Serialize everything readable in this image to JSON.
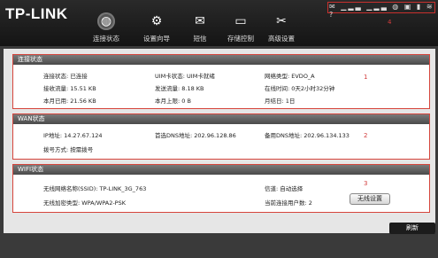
{
  "header": {
    "logo": "TP-LINK",
    "nav": [
      {
        "label": "连接状态",
        "icon": "globe-icon"
      },
      {
        "label": "设置向导",
        "icon": "gear-icon"
      },
      {
        "label": "短信",
        "icon": "mail-icon"
      },
      {
        "label": "存储控制",
        "icon": "storage-icon"
      },
      {
        "label": "高级设置",
        "icon": "tools-icon"
      }
    ],
    "status_icons": [
      "mail-icon",
      "signal-icon",
      "signal-icon",
      "globe-icon",
      "sim-icon",
      "battery-icon",
      "wifi-icon",
      "help-icon"
    ],
    "annotation": "4"
  },
  "connection": {
    "title": "连接状态",
    "mark": "1",
    "rows": [
      [
        "连接状态: 已连接",
        "UIM卡状态: UIM卡就绪",
        "网络类型: EVDO_A"
      ],
      [
        "接收流量: 15.51 KB",
        "发送流量: 8.18 KB",
        "在线时间: 0天2小时32分钟"
      ],
      [
        "本月已用: 21.56 KB",
        "本月上限: 0 B",
        "月结日: 1日"
      ]
    ]
  },
  "wan": {
    "title": "WAN状态",
    "mark": "2",
    "rows": [
      [
        "IP地址: 14.27.67.124",
        "首选DNS地址: 202.96.128.86",
        "备用DNS地址: 202.96.134.133"
      ],
      [
        "拨号方式: 按需拨号"
      ]
    ]
  },
  "wifi": {
    "title": "WIFI状态",
    "mark": "3",
    "ssid": "无线网络名称(SSID): TP-LINK_3G_763",
    "channel": "信道: 自动选择",
    "encryption": "无线加密类型: WPA/WPA2-PSK",
    "users": "当前连接用户数: 2",
    "settings_btn": "无线设置"
  },
  "refresh_btn": "刷新"
}
